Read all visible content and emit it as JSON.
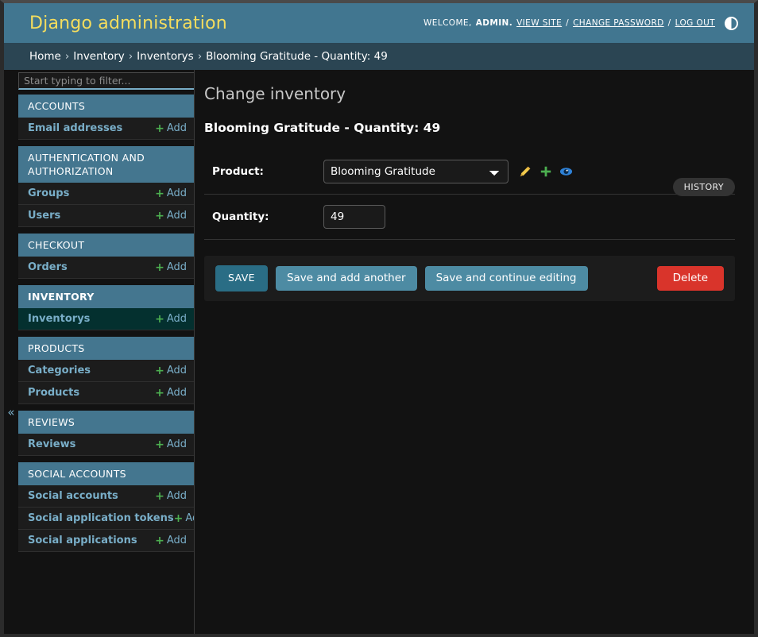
{
  "header": {
    "branding": "Django administration",
    "welcome_text": "WELCOME,",
    "username": "ADMIN.",
    "links": [
      {
        "label": "VIEW SITE"
      },
      {
        "label": "CHANGE PASSWORD"
      },
      {
        "label": "LOG OUT"
      }
    ],
    "separator": "/",
    "theme_toggle_icon": "contrast-circle-icon"
  },
  "breadcrumbs": {
    "separator": "›",
    "items": [
      {
        "label": "Home"
      },
      {
        "label": "Inventory"
      },
      {
        "label": "Inventorys"
      },
      {
        "label": "Blooming Gratitude - Quantity: 49"
      }
    ]
  },
  "sidebar": {
    "filter_placeholder": "Start typing to filter...",
    "filter_value": "",
    "collapse_icon": "«",
    "add_label": "Add",
    "plus_icon": "+",
    "modules": [
      {
        "caption": "ACCOUNTS",
        "current": false,
        "models": [
          {
            "label": "Email addresses",
            "current": false
          }
        ]
      },
      {
        "caption": "AUTHENTICATION AND AUTHORIZATION",
        "current": false,
        "models": [
          {
            "label": "Groups",
            "current": false
          },
          {
            "label": "Users",
            "current": false
          }
        ]
      },
      {
        "caption": "CHECKOUT",
        "current": false,
        "models": [
          {
            "label": "Orders",
            "current": false
          }
        ]
      },
      {
        "caption": "INVENTORY",
        "current": true,
        "models": [
          {
            "label": "Inventorys",
            "current": true
          }
        ]
      },
      {
        "caption": "PRODUCTS",
        "current": false,
        "models": [
          {
            "label": "Categories",
            "current": false
          },
          {
            "label": "Products",
            "current": false
          }
        ]
      },
      {
        "caption": "REVIEWS",
        "current": false,
        "models": [
          {
            "label": "Reviews",
            "current": false
          }
        ]
      },
      {
        "caption": "SOCIAL ACCOUNTS",
        "current": false,
        "models": [
          {
            "label": "Social accounts",
            "current": false
          },
          {
            "label": "Social application tokens",
            "current": false
          },
          {
            "label": "Social applications",
            "current": false
          }
        ]
      }
    ]
  },
  "content": {
    "title": "Change inventory",
    "object_name": "Blooming Gratitude - Quantity: 49",
    "history_label": "HISTORY",
    "fields": {
      "product": {
        "label": "Product:",
        "selected": "Blooming Gratitude",
        "options": [
          "Blooming Gratitude"
        ],
        "related_icons": [
          "pencil-edit-icon",
          "plus-add-icon",
          "eye-view-icon"
        ]
      },
      "quantity": {
        "label": "Quantity:",
        "value": "49"
      }
    },
    "submit_row": {
      "save": "SAVE",
      "save_and_add_another": "Save and add another",
      "save_and_continue": "Save and continue editing",
      "delete": "Delete"
    }
  },
  "colors": {
    "header_bg": "#417690",
    "breadcrumb_bg": "#2b4553",
    "brand_text": "#f5dd5d",
    "link_blue": "#79aec8",
    "module_caption_bg": "#44768f",
    "current_model_bg": "#04302f",
    "page_bg": "#121212",
    "delete_red": "#d9342b",
    "save_teal": "#2a6d85",
    "secondary_blue": "#4d8ba3",
    "plus_green": "#4caf50",
    "pencil_yellow": "#efb73e",
    "eye_blue": "#2e82d8"
  }
}
